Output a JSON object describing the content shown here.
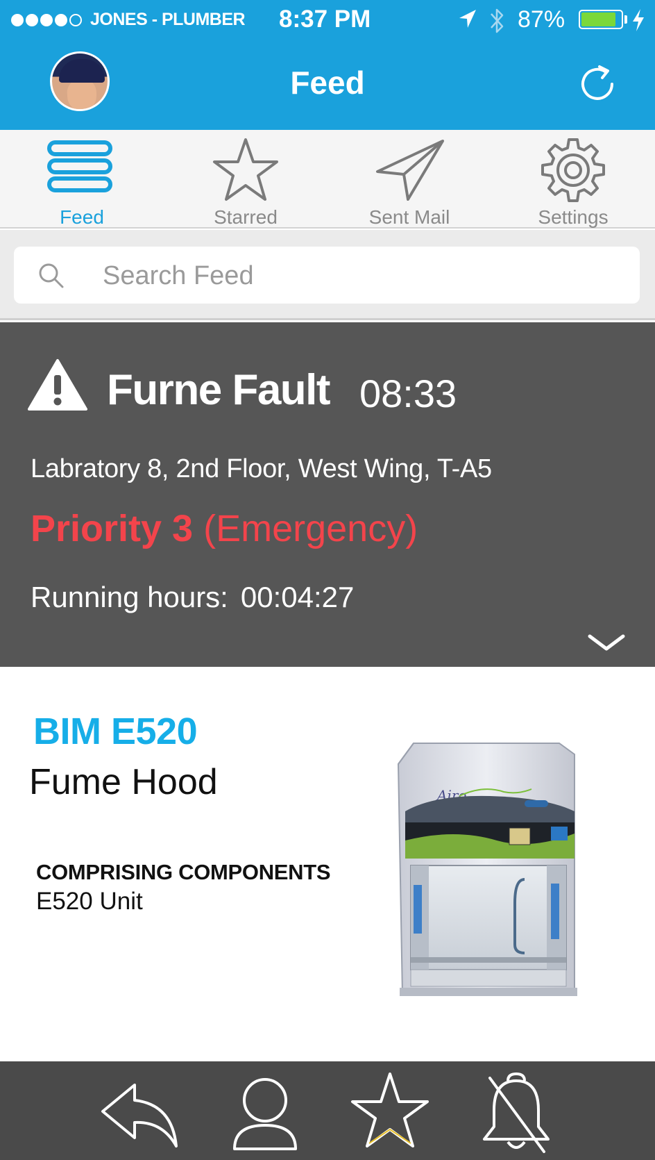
{
  "status_bar": {
    "carrier": "JONES - PLUMBER",
    "time": "8:37 PM",
    "battery_percent": "87%",
    "battery_level": 0.87,
    "battery_color": "#7bd83a"
  },
  "header": {
    "title": "Feed",
    "background": "#1aa1dc"
  },
  "tabs": [
    {
      "label": "Feed",
      "icon": "menu-icon",
      "active": true
    },
    {
      "label": "Starred",
      "icon": "star-icon",
      "active": false
    },
    {
      "label": "Sent Mail",
      "icon": "paper-plane-icon",
      "active": false
    },
    {
      "label": "Settings",
      "icon": "gear-icon",
      "active": false
    }
  ],
  "search": {
    "placeholder": "Search Feed",
    "value": ""
  },
  "alert": {
    "title": "Furne Fault",
    "time": "08:33",
    "location": "Labratory 8, 2nd Floor, West Wing, T-A5",
    "priority_label": "Priority 3",
    "priority_level": "(Emergency)",
    "priority_color": "#f3444b",
    "running_label": "Running hours:",
    "running_value": "00:04:27"
  },
  "asset": {
    "code": "BIM E520",
    "name": "Fume Hood",
    "components_heading": "COMPRISING COMPONENTS",
    "components": [
      "E520 Unit"
    ],
    "accent_color": "#16aee8",
    "image_logo_text": "Airo"
  },
  "toolbar": {
    "icons": [
      "reply-icon",
      "person-icon",
      "star-icon",
      "bell-off-icon"
    ]
  }
}
